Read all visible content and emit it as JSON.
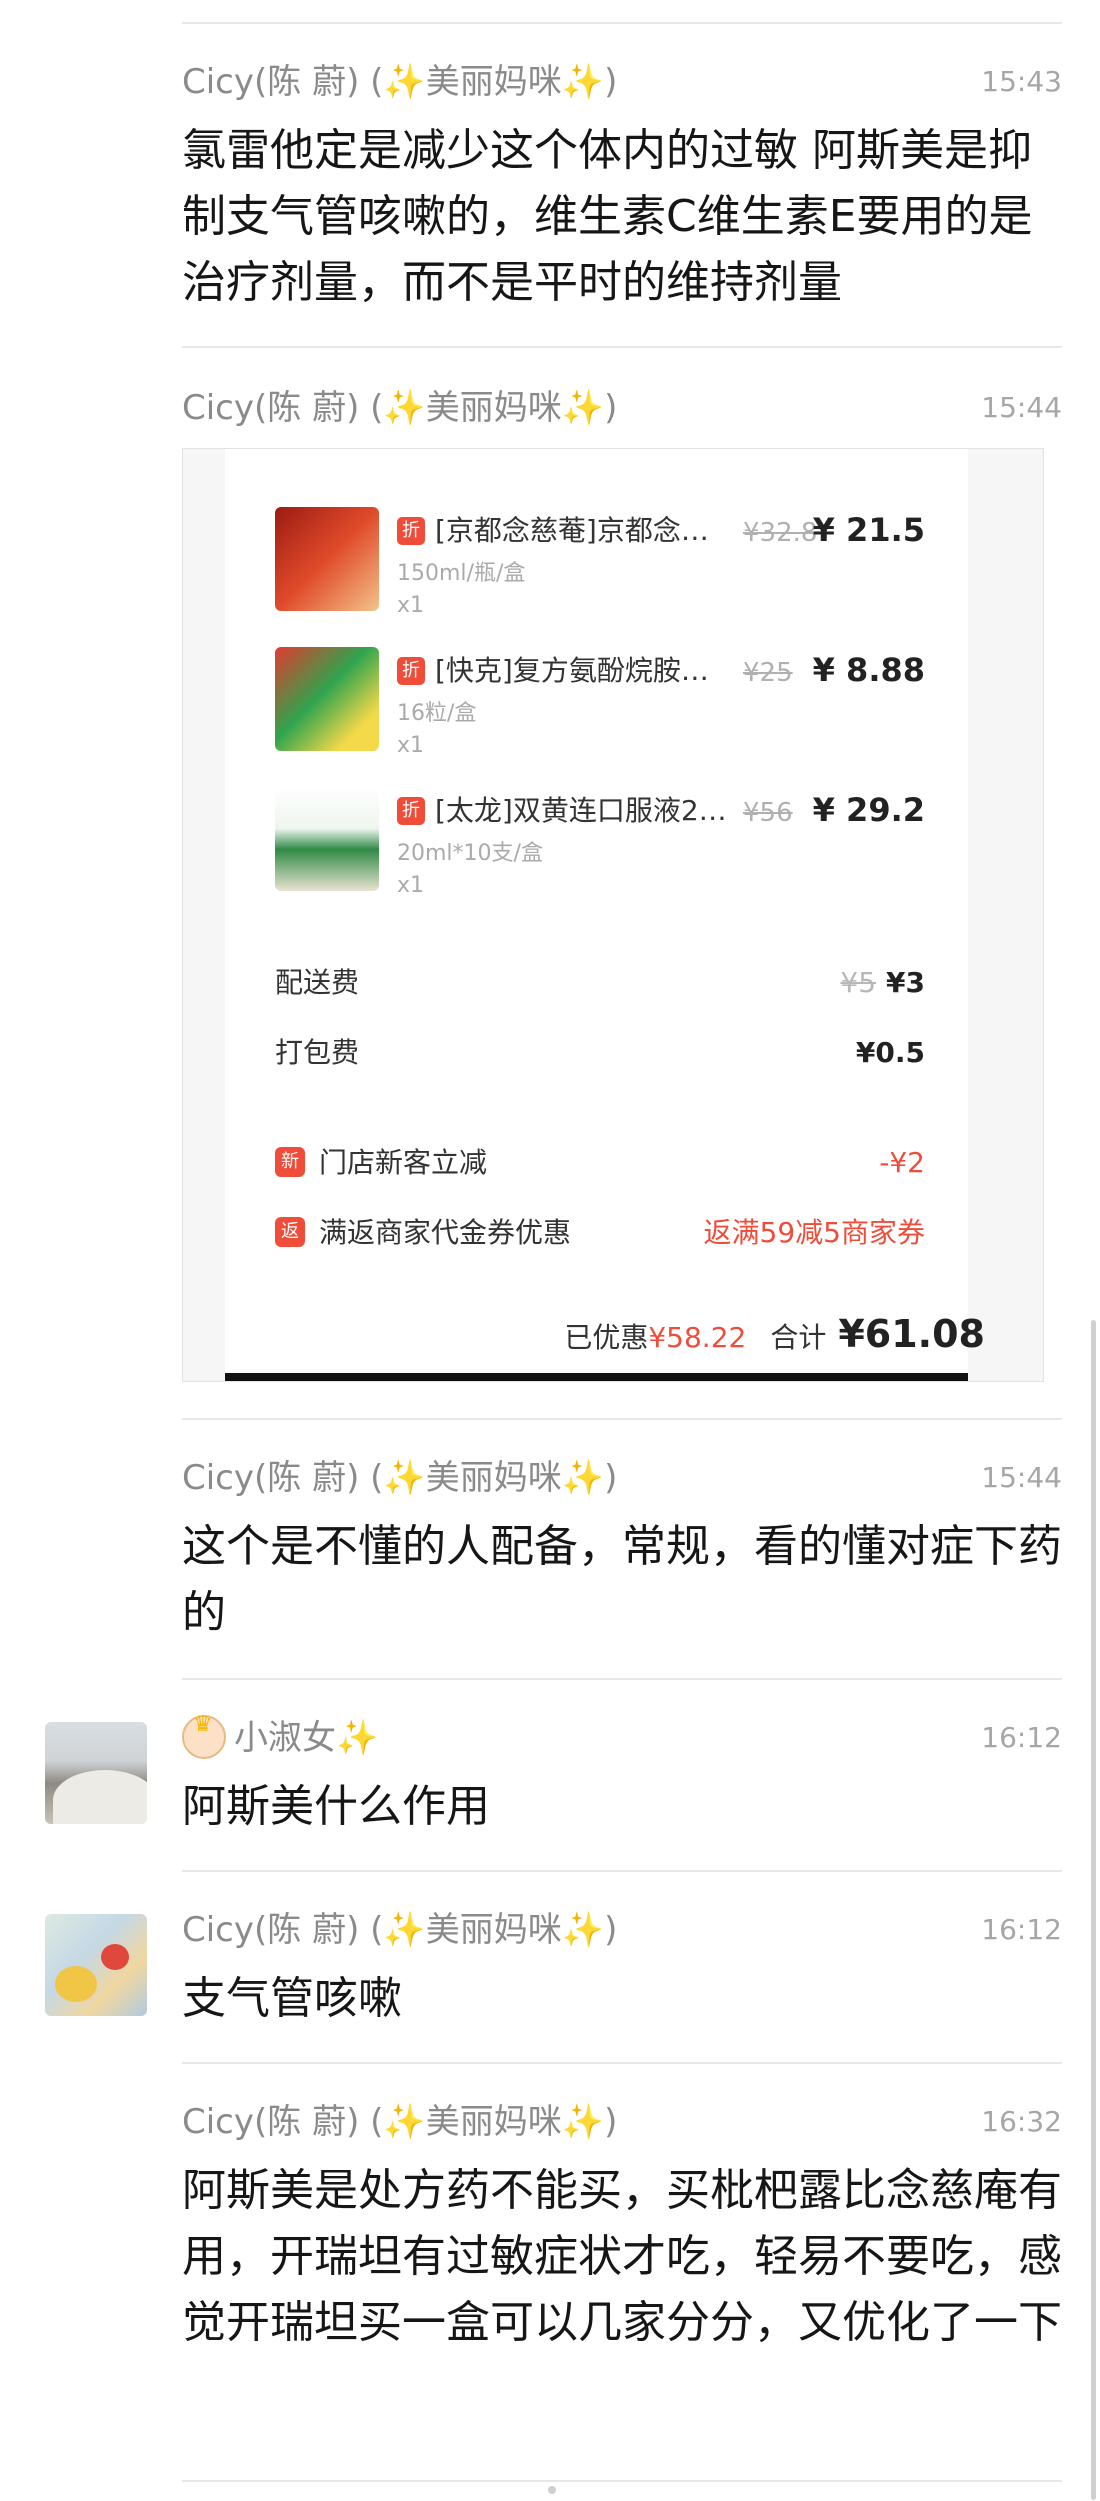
{
  "messages": [
    {
      "sender": "Cicy(陈 蔚)",
      "tag_open": " (",
      "tag_sparkle1": "✨",
      "tag_text": "美丽妈咪",
      "tag_sparkle2": "✨",
      "tag_close": ")",
      "time": "15:43",
      "text": "氯雷他定是减少这个体内的过敏 阿斯美是抑制支气管咳嗽的，维生素C维生素E要用的是治疗剂量，而不是平时的维持剂量"
    },
    {
      "sender": "Cicy(陈 蔚)",
      "tag_open": " (",
      "tag_sparkle1": "✨",
      "tag_text": "美丽妈咪",
      "tag_sparkle2": "✨",
      "tag_close": ")",
      "time": "15:44"
    },
    {
      "sender": "Cicy(陈 蔚)",
      "tag_open": " (",
      "tag_sparkle1": "✨",
      "tag_text": "美丽妈咪",
      "tag_sparkle2": "✨",
      "tag_close": ")",
      "time": "15:44",
      "text": "这个是不懂的人配备，常规，看的懂对症下药的"
    },
    {
      "sender": "小淑女",
      "sender_sparkle": "✨",
      "time": "16:12",
      "text": "阿斯美什么作用"
    },
    {
      "sender": "Cicy(陈 蔚)",
      "tag_open": " (",
      "tag_sparkle1": "✨",
      "tag_text": "美丽妈咪",
      "tag_sparkle2": "✨",
      "tag_close": ")",
      "time": "16:12",
      "text": "支气管咳嗽"
    },
    {
      "sender": "Cicy(陈 蔚)",
      "tag_open": " (",
      "tag_sparkle1": "✨",
      "tag_text": "美丽妈咪",
      "tag_sparkle2": "✨",
      "tag_close": ")",
      "time": "16:32",
      "text": "阿斯美是处方药不能买，买枇杷露比念慈庵有用，开瑞坦有过敏症状才吃，轻易不要吃，感觉开瑞坦买一盒可以几家分分，又优化了一下"
    }
  ],
  "order": {
    "items": [
      {
        "tag": "折",
        "name": "[京都念慈菴]京都念慈...",
        "old_price": "¥32.8",
        "price": "¥ 21.5",
        "spec": "150ml/瓶/盒",
        "qty": "x1"
      },
      {
        "tag": "折",
        "name": "[快克]复方氨酚烷胺胶囊...",
        "old_price": "¥25",
        "price": "¥ 8.88",
        "spec": "16粒/盒",
        "qty": "x1"
      },
      {
        "tag": "折",
        "name": "[太龙]双黄连口服液20m...",
        "old_price": "¥56",
        "price": "¥ 29.2",
        "spec": "20ml*10支/盒",
        "qty": "x1"
      }
    ],
    "delivery_label": "配送费",
    "delivery_old": "¥5",
    "delivery_price": "¥3",
    "packing_label": "打包费",
    "packing_price": "¥0.5",
    "newcust_tag": "新",
    "newcust_label": "门店新客立减",
    "newcust_value": "-¥2",
    "rebate_tag": "返",
    "rebate_label": "满返商家代金券优惠",
    "rebate_value": "返满59减5商家券",
    "discounted_label": "已优惠",
    "discounted_value": "¥58.22",
    "total_label": "合计",
    "total_value": "¥61.08"
  },
  "colors": {
    "accent_red": "#ef4d3a",
    "sparkle": "#f6c12a"
  }
}
